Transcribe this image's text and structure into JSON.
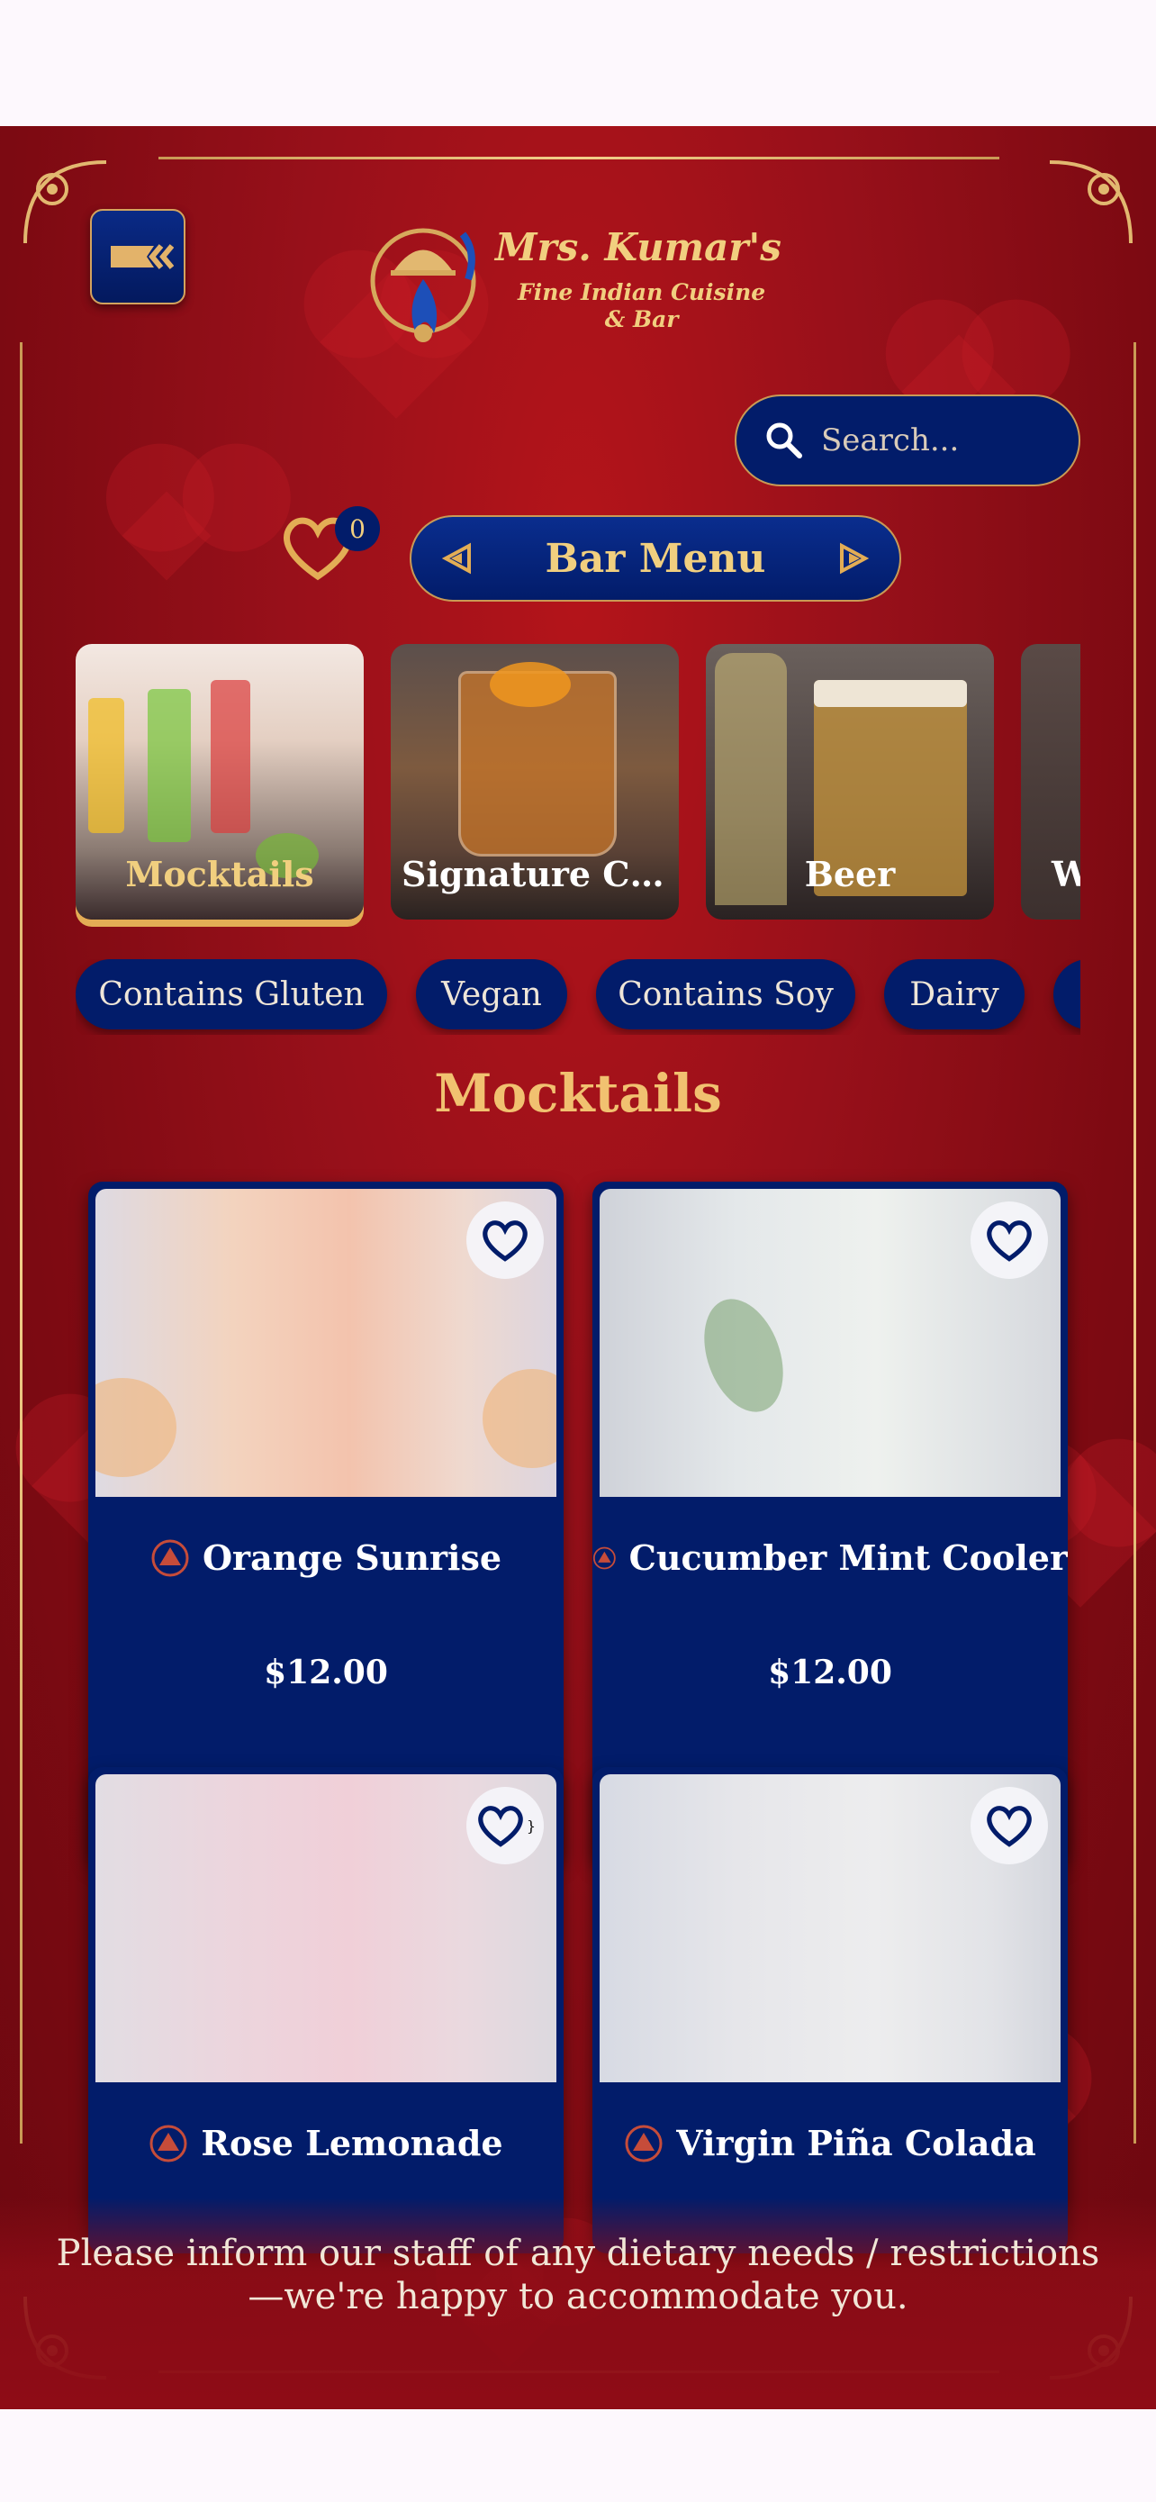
{
  "brand": {
    "title": "Mrs. Kumar's",
    "subtitle_1": "Fine Indian Cuisine",
    "subtitle_2": "& Bar"
  },
  "search": {
    "placeholder": "Search..."
  },
  "favorites": {
    "count": "0"
  },
  "menu_switcher": {
    "label": "Bar Menu"
  },
  "categories": [
    {
      "label": "Mocktails",
      "active": true
    },
    {
      "label": "Signature Cock...",
      "active": false
    },
    {
      "label": "Beer",
      "active": false
    },
    {
      "label": "W",
      "active": false
    }
  ],
  "filters": [
    "Contains Gluten",
    "Vegan",
    "Contains Soy",
    "Dairy"
  ],
  "section": {
    "title": "Mocktails"
  },
  "items": [
    {
      "name": "Orange Sunrise",
      "price": "$12.00"
    },
    {
      "name": "Cucumber Mint Cooler",
      "price": "$12.00"
    },
    {
      "name": "Rose Lemonade",
      "price": ""
    },
    {
      "name": "Virgin Piña Colada",
      "price": ""
    }
  ],
  "footer": {
    "line_1": "Please inform our staff of any dietary needs / restrictions",
    "line_2": "—we're happy to accommodate you."
  },
  "colors": {
    "background_red": "#98101a",
    "navy": "#021c6a",
    "gold": "#f1cf7f",
    "active_underline": "#e3ad55"
  }
}
